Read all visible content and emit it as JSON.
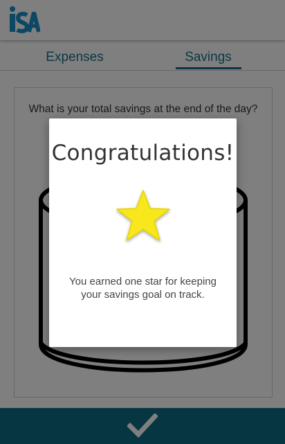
{
  "header": {
    "logo_text": "iSA",
    "logo_icon": "isa-logo-icon",
    "logo_color": "#1b8fc7"
  },
  "tabs": [
    {
      "label": "Expenses",
      "selected": false
    },
    {
      "label": "Savings",
      "selected": true
    }
  ],
  "main": {
    "question": "What is your total savings at the end of the day?",
    "jar_icon": "jar-icon"
  },
  "bottom_bar": {
    "icon": "checkmark-icon",
    "color": "#0f6c86"
  },
  "dialog": {
    "title": "Congratulations!",
    "icon": "star-icon",
    "star_color": "#f8e71c",
    "message": "You earned one star for keeping your savings goal on track."
  },
  "colors": {
    "accent": "#1a6f8a",
    "overlay": "rgba(0,0,0,0.5)"
  }
}
